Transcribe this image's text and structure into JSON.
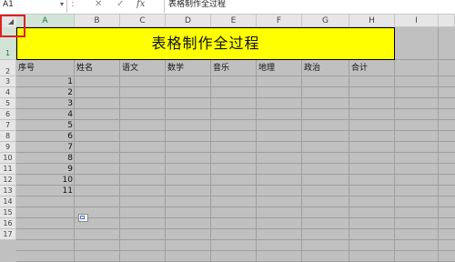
{
  "formula_bar": {
    "name_box": "A1",
    "name_box_dropdown_icon": "chevron-down-icon",
    "more_icon": "vertical-dots-icon",
    "cancel_symbol": "✕",
    "confirm_symbol": "✓",
    "fx_label": "fx",
    "content": "表格制作全过程"
  },
  "columns": [
    "A",
    "B",
    "C",
    "D",
    "E",
    "F",
    "G",
    "H",
    "I"
  ],
  "selected_column": "A",
  "rows": [
    "1",
    "2",
    "3",
    "4",
    "5",
    "6",
    "7",
    "8",
    "9",
    "10",
    "11",
    "12",
    "13",
    "14",
    "15",
    "16",
    "17"
  ],
  "selected_row": "1",
  "sheet": {
    "title": "表格制作全过程",
    "headers": [
      "序号",
      "姓名",
      "语文",
      "数学",
      "音乐",
      "地理",
      "政治",
      "合计"
    ],
    "serial_numbers": [
      "1",
      "2",
      "3",
      "4",
      "5",
      "6",
      "7",
      "8",
      "9",
      "10",
      "11"
    ]
  },
  "colors": {
    "title_fill": "#ffff00",
    "highlight_box": "#e02020",
    "selected_header": "#217346",
    "grid_background": "#c0c0c0"
  }
}
